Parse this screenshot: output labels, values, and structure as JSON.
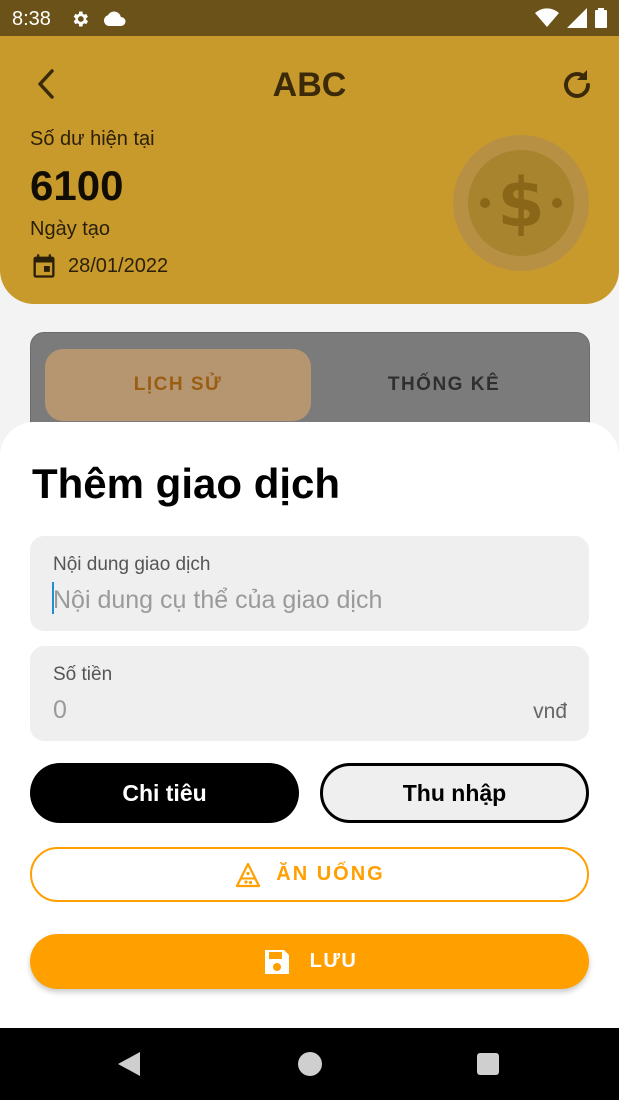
{
  "status_bar": {
    "time": "8:38",
    "icons": [
      "gear-icon",
      "cloud-icon",
      "wifi-icon",
      "signal-icon",
      "battery-icon"
    ]
  },
  "header": {
    "title": "ABC",
    "balance_label": "Số dư hiện tại",
    "balance_value": "6100",
    "date_label": "Ngày tạo",
    "date_value": "28/01/2022",
    "accent_color": "#c89a2c"
  },
  "tabs": [
    {
      "label": "LỊCH SỬ",
      "selected": true
    },
    {
      "label": "THỐNG KÊ",
      "selected": false
    }
  ],
  "sheet": {
    "title": "Thêm giao dịch",
    "description_field": {
      "label": "Nội dung giao dịch",
      "placeholder": "Nội dung cụ thể của giao dịch",
      "value": ""
    },
    "amount_field": {
      "label": "Số tiền",
      "placeholder": "0",
      "value": "",
      "suffix": "vnđ"
    },
    "type_buttons": {
      "expense": "Chi tiêu",
      "income": "Thu nhập",
      "selected": "expense"
    },
    "category": {
      "label": "ĂN UỐNG",
      "icon": "pizza-icon"
    },
    "save": {
      "label": "LƯU",
      "icon": "save-icon"
    },
    "primary_color": "#ff9f00"
  },
  "nav_bar": {
    "icons": [
      "back-triangle-icon",
      "home-circle-icon",
      "recents-square-icon"
    ]
  }
}
